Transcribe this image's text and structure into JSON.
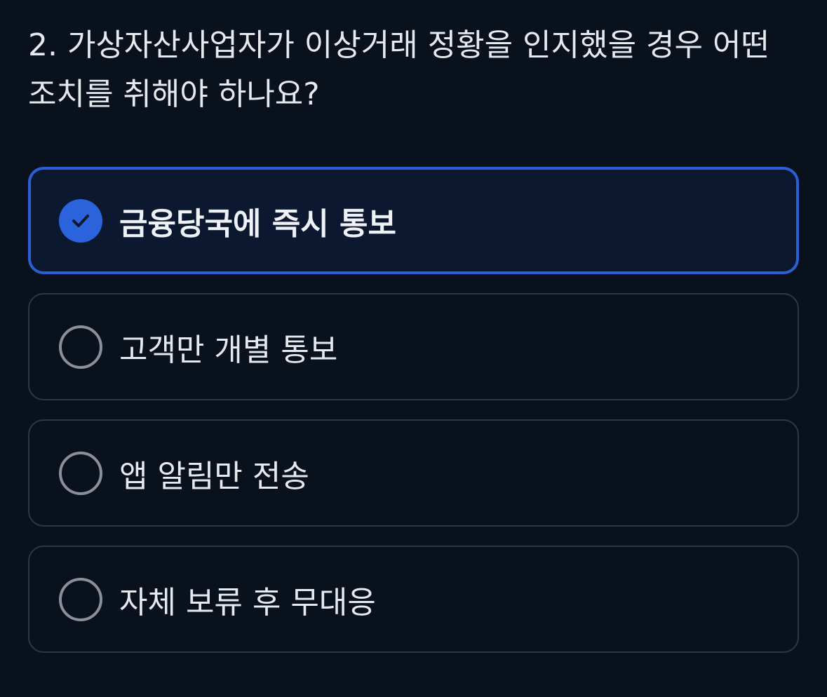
{
  "question": {
    "text": "2. 가상자산사업자가 이상거래 정황을 인지했을 경우 어떤 조치를 취해야 하나요?"
  },
  "options": [
    {
      "label": "금융당국에 즉시 통보",
      "selected": true
    },
    {
      "label": "고객만 개별 통보",
      "selected": false
    },
    {
      "label": "앱 알림만 전송",
      "selected": false
    },
    {
      "label": "자체 보류 후 무대응",
      "selected": false
    }
  ],
  "colors": {
    "background": "#09111c",
    "accent": "#2a63dc",
    "selected_border": "#2a5fd6",
    "option_border": "#2f3744",
    "radio_border": "#8a8f98"
  },
  "icons": {
    "selected": "check-circle-icon",
    "unselected": "radio-empty-icon"
  }
}
